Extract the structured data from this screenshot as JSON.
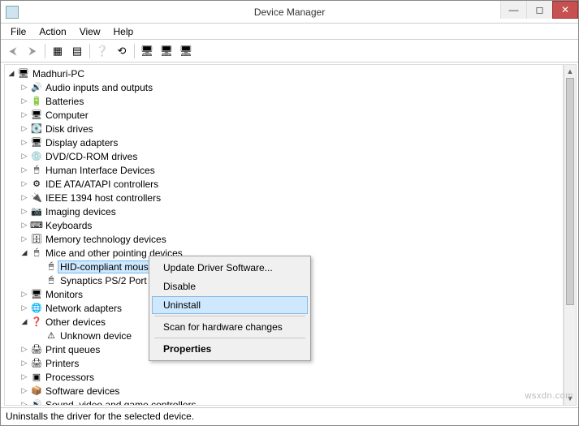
{
  "window": {
    "title": "Device Manager"
  },
  "menu": {
    "file": "File",
    "action": "Action",
    "view": "View",
    "help": "Help"
  },
  "toolbar": {
    "back": "◄",
    "forward": "►",
    "show_hidden": "🗂",
    "refresh": "⟳",
    "properties": "📄",
    "update": "🖥",
    "uninstall": "🖥",
    "scan": "🖥",
    "help": "❔"
  },
  "tree": {
    "root": "Madhuri-PC",
    "items": [
      {
        "label": "Audio inputs and outputs",
        "icon": "🔊"
      },
      {
        "label": "Batteries",
        "icon": "🔋"
      },
      {
        "label": "Computer",
        "icon": "🖥"
      },
      {
        "label": "Disk drives",
        "icon": "💽"
      },
      {
        "label": "Display adapters",
        "icon": "🖥"
      },
      {
        "label": "DVD/CD-ROM drives",
        "icon": "💿"
      },
      {
        "label": "Human Interface Devices",
        "icon": "🖱"
      },
      {
        "label": "IDE ATA/ATAPI controllers",
        "icon": "⚙"
      },
      {
        "label": "IEEE 1394 host controllers",
        "icon": "🔌"
      },
      {
        "label": "Imaging devices",
        "icon": "📷"
      },
      {
        "label": "Keyboards",
        "icon": "⌨"
      },
      {
        "label": "Memory technology devices",
        "icon": "🗄"
      },
      {
        "label": "Mice and other pointing devices",
        "icon": "🖱",
        "expanded": true,
        "children": [
          {
            "label": "HID-compliant mouse",
            "icon": "🖱",
            "selected": true
          },
          {
            "label": "Synaptics PS/2 Port",
            "icon": "🖱"
          }
        ]
      },
      {
        "label": "Monitors",
        "icon": "🖥"
      },
      {
        "label": "Network adapters",
        "icon": "🌐"
      },
      {
        "label": "Other devices",
        "icon": "❓",
        "expanded": true,
        "children": [
          {
            "label": "Unknown device",
            "icon": "⚠"
          }
        ]
      },
      {
        "label": "Print queues",
        "icon": "🖨"
      },
      {
        "label": "Printers",
        "icon": "🖨"
      },
      {
        "label": "Processors",
        "icon": "▣"
      },
      {
        "label": "Software devices",
        "icon": "📦"
      },
      {
        "label": "Sound, video and game controllers",
        "icon": "🔊"
      }
    ]
  },
  "context_menu": {
    "update": "Update Driver Software...",
    "disable": "Disable",
    "uninstall": "Uninstall",
    "scan": "Scan for hardware changes",
    "properties": "Properties"
  },
  "status": "Uninstalls the driver for the selected device.",
  "watermark": "wsxdn.com"
}
